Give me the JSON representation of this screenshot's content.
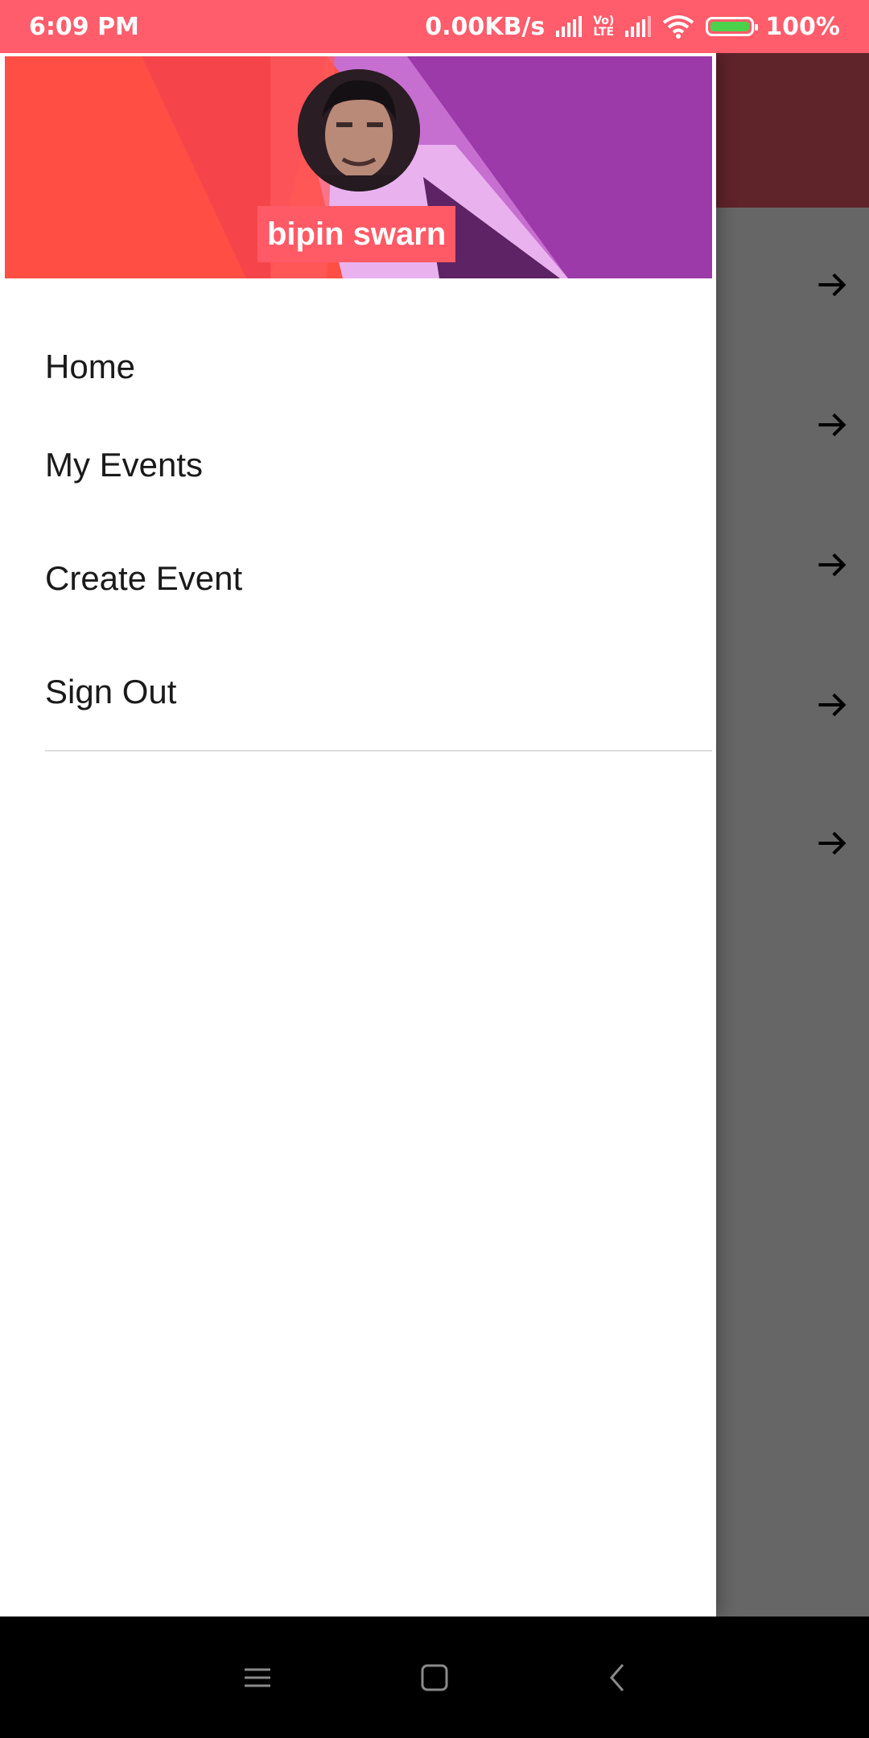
{
  "status_bar": {
    "time": "6:09 PM",
    "net_speed": "0.00KB/s",
    "lte_top": "Vo)",
    "lte_bottom": "LTE",
    "battery": "100%",
    "icons": [
      "signal-icon",
      "volte-icon",
      "signal-icon",
      "wifi-icon",
      "battery-charging-icon"
    ]
  },
  "drawer": {
    "user_name": "bipin swarn",
    "items": [
      {
        "label": "Home"
      },
      {
        "label": "My Events"
      },
      {
        "label": "Create Event"
      },
      {
        "label": "Sign Out"
      }
    ]
  },
  "background_app": {
    "arrow_icon": "arrow-right-icon",
    "arrow_count": 5
  },
  "nav_bar": {
    "icons": [
      "menu-icon",
      "home-square-icon",
      "back-chevron-icon"
    ]
  },
  "colors": {
    "status_bar": "#ff5c6c",
    "header_red": "#ff4f45",
    "header_purple": "#9b3aa8",
    "name_bg": "#ff5a66"
  }
}
